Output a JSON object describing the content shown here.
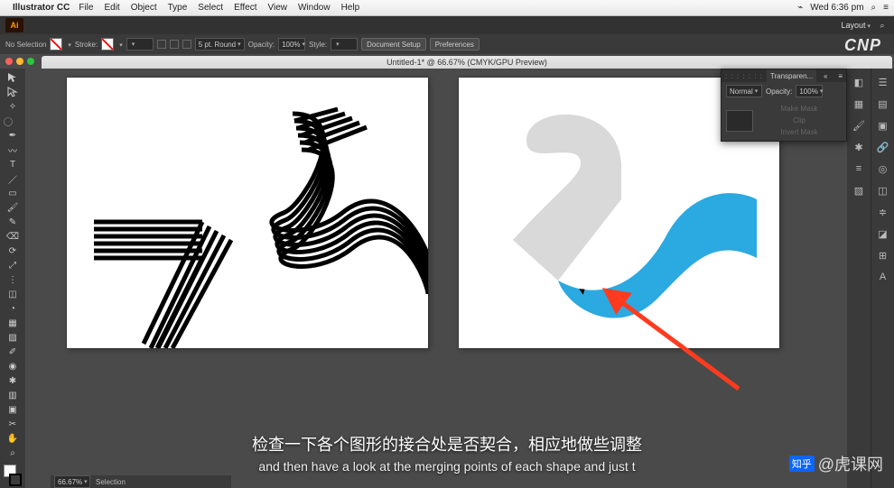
{
  "mac_menu": {
    "app": "Illustrator CC",
    "items": [
      "File",
      "Edit",
      "Object",
      "Type",
      "Select",
      "Effect",
      "View",
      "Window",
      "Help"
    ],
    "right": {
      "battery": "⌁",
      "clock": "Wed 6:36 pm",
      "search": "⌕",
      "menu": "≡"
    }
  },
  "ai_top": {
    "logo": "Ai",
    "layout": "Layout",
    "brand": "CNP"
  },
  "control_bar": {
    "no_selection": "No Selection",
    "stroke_label": "Stroke:",
    "stroke_weight": "",
    "stroke_profile": "5 pt. Round",
    "opacity_label": "Opacity:",
    "opacity_value": "100%",
    "style_label": "Style:",
    "doc_setup": "Document Setup",
    "preferences": "Preferences"
  },
  "doc_tab": {
    "title": "Untitled-1* @ 66.67% (CMYK/GPU Preview)"
  },
  "tools": [
    "sel",
    "dsel",
    "wand",
    "lasso",
    "pen",
    "curv",
    "type",
    "line",
    "rect",
    "brush",
    "pencil",
    "eraser",
    "rotate",
    "scale",
    "width",
    "free",
    "shb",
    "mesh",
    "grad",
    "eyed",
    "blend",
    "sym",
    "graph",
    "art",
    "slice",
    "hand",
    "zoom"
  ],
  "right_icons_a": [
    "color",
    "swatch",
    "brushlib",
    "symlib",
    "stroke2",
    "grad2"
  ],
  "right_icons_b": [
    "layers",
    "artb",
    "link",
    "appear",
    "graphic",
    "align",
    "path",
    "trans",
    "char",
    "para"
  ],
  "transparency_panel": {
    "tab": "Transparen...",
    "mode": "Normal",
    "opacity_label": "Opacity:",
    "opacity_value": "100%",
    "make_mask": "Make Mask",
    "clip": "Clip",
    "invert": "Invert Mask"
  },
  "subtitles": {
    "cn": "检查一下各个图形的接合处是否契合，相应地做些调整",
    "en": "and then have a look at the merging points of each shape and just t"
  },
  "watermark": {
    "zhihu": "知乎",
    "site": "@虎课网"
  },
  "status": {
    "zoom": "66.67%",
    "tool": "Selection"
  }
}
